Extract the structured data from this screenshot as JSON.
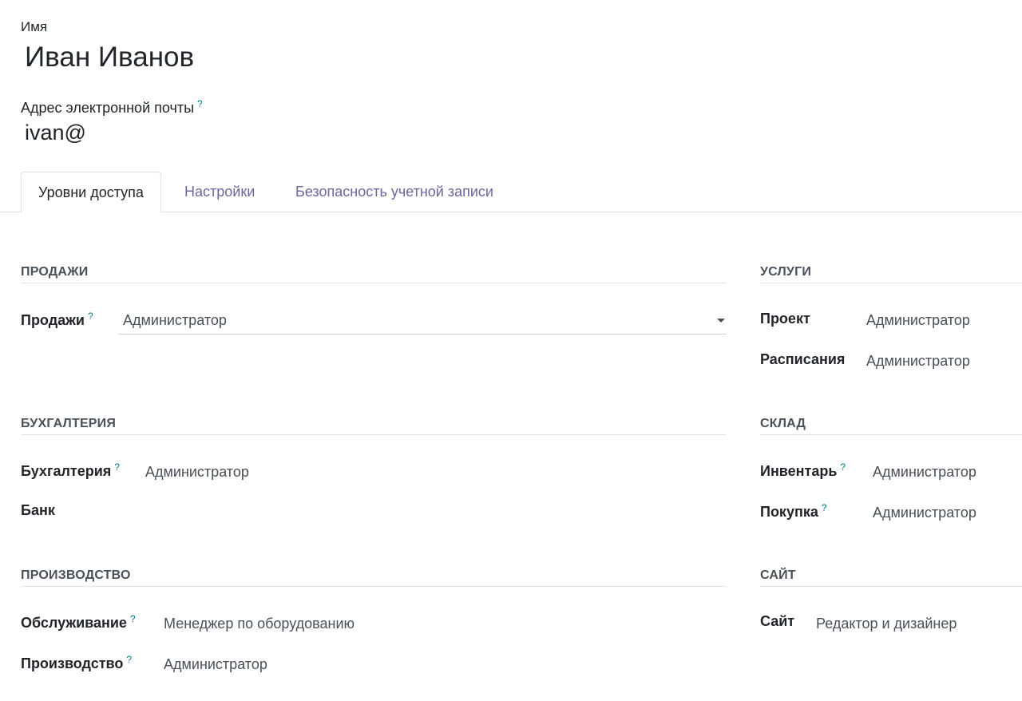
{
  "form": {
    "name_label": "Имя",
    "name_value": "Иван Иванов",
    "email_label": "Адрес электронной почты",
    "email_value": "ivan@",
    "help_mark": "?"
  },
  "tabs": [
    {
      "label": "Уровни доступа",
      "active": true
    },
    {
      "label": "Настройки",
      "active": false
    },
    {
      "label": "Безопасность учетной записи",
      "active": false
    }
  ],
  "sections": {
    "sales": {
      "title": "ПРОДАЖИ",
      "fields": [
        {
          "label": "Продажи",
          "value": "Администратор",
          "help": true
        }
      ]
    },
    "services": {
      "title": "УСЛУГИ",
      "fields": [
        {
          "label": "Проект",
          "value": "Администратор"
        },
        {
          "label": "Расписания",
          "value": "Администратор"
        }
      ]
    },
    "accounting": {
      "title": "БУХГАЛТЕРИЯ",
      "fields": [
        {
          "label": "Бухгалтерия",
          "value": "Администратор",
          "help": true
        },
        {
          "label": "Банк",
          "value": ""
        }
      ]
    },
    "warehouse": {
      "title": "СКЛАД",
      "fields": [
        {
          "label": "Инвентарь",
          "value": "Администратор",
          "help": true
        },
        {
          "label": "Покупка",
          "value": "Администратор",
          "help": true
        }
      ]
    },
    "manufacturing": {
      "title": "ПРОИЗВОДСТВО",
      "fields": [
        {
          "label": "Обслуживание",
          "value": "Менеджер по оборудованию",
          "help": true
        },
        {
          "label": "Производство",
          "value": "Администратор",
          "help": true
        }
      ]
    },
    "website": {
      "title": "САЙТ",
      "fields": [
        {
          "label": "Сайт",
          "value": "Редактор и дизайнер"
        }
      ]
    }
  },
  "colors": {
    "accent": "#017e84",
    "tab_inactive": "#71639e",
    "border": "#dee2e6"
  }
}
